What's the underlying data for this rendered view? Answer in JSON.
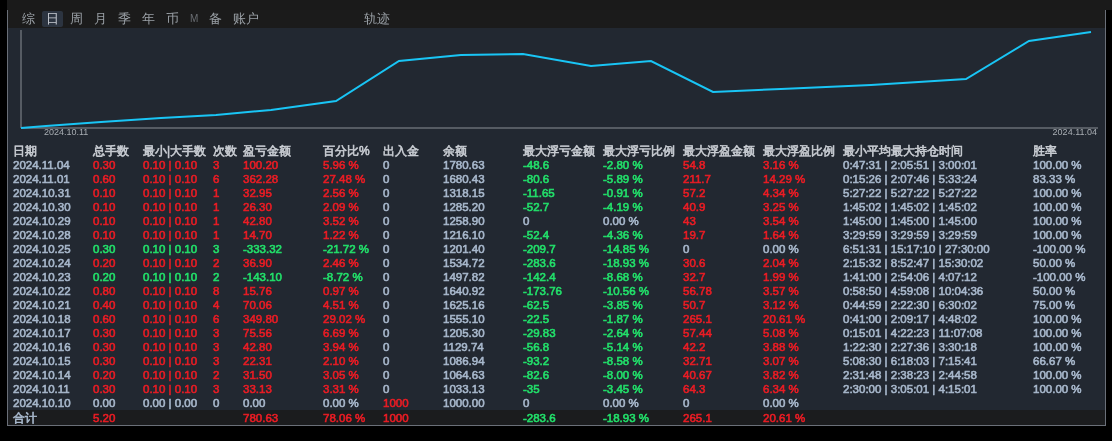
{
  "tabs": [
    {
      "label": "综",
      "selected": false,
      "dim": false
    },
    {
      "label": "日",
      "selected": true,
      "dim": false
    },
    {
      "label": "周",
      "selected": false,
      "dim": false
    },
    {
      "label": "月",
      "selected": false,
      "dim": false
    },
    {
      "label": "季",
      "selected": false,
      "dim": false
    },
    {
      "label": "年",
      "selected": false,
      "dim": false
    },
    {
      "label": "币",
      "selected": false,
      "dim": false
    },
    {
      "label": "M",
      "selected": false,
      "dim": true
    },
    {
      "label": "备",
      "selected": false,
      "dim": false
    },
    {
      "label": "账户",
      "selected": false,
      "dim": false
    },
    {
      "label": "轨迹",
      "selected": false,
      "dim": false,
      "kind": "far"
    }
  ],
  "chart": {
    "start_label": "2024.10.11",
    "end_label": "2024.11.04"
  },
  "table": {
    "columns": [
      "日期",
      "总手数",
      "最小|大手数",
      "次数",
      "盈亏金额",
      "百分比%",
      "出入金",
      "余额",
      "最大浮亏金额",
      "最大浮亏比例",
      "最大浮盈金额",
      "最大浮盈比例",
      "最小平均最大持仓时间",
      "胜率"
    ],
    "rows": [
      {
        "cells": [
          {
            "text": "2024.11.04",
            "color": "#a8b8cc"
          },
          {
            "text": "0.30",
            "color": "#ec1c24"
          },
          {
            "text": "0.10 | 0.10",
            "color": "#ec1c24"
          },
          {
            "text": "3",
            "color": "#ec1c24"
          },
          {
            "text": "100.20",
            "color": "#ec1c24"
          },
          {
            "text": "5.96 %",
            "color": "#ec1c24"
          },
          {
            "text": "0",
            "color": "#a8b8cc"
          },
          {
            "text": "1780.63",
            "color": "#a8b8cc"
          },
          {
            "text": "-48.6",
            "color": "#22e06a"
          },
          {
            "text": "-2.80 %",
            "color": "#22e06a"
          },
          {
            "text": "54.8",
            "color": "#ec1c24"
          },
          {
            "text": "3.16 %",
            "color": "#ec1c24"
          },
          {
            "text": "0:47:31 | 2:05:51 | 3:00:01",
            "color": "#a8b8cc"
          },
          {
            "text": "100.00 %",
            "color": "#a8b8cc"
          }
        ]
      },
      {
        "cells": [
          {
            "text": "2024.11.01",
            "color": "#a8b8cc"
          },
          {
            "text": "0.60",
            "color": "#ec1c24"
          },
          {
            "text": "0.10 | 0.10",
            "color": "#ec1c24"
          },
          {
            "text": "6",
            "color": "#ec1c24"
          },
          {
            "text": "362.28",
            "color": "#ec1c24"
          },
          {
            "text": "27.48 %",
            "color": "#ec1c24"
          },
          {
            "text": "0",
            "color": "#a8b8cc"
          },
          {
            "text": "1680.43",
            "color": "#a8b8cc"
          },
          {
            "text": "-80.6",
            "color": "#22e06a"
          },
          {
            "text": "-5.89 %",
            "color": "#22e06a"
          },
          {
            "text": "211.7",
            "color": "#ec1c24"
          },
          {
            "text": "14.29 %",
            "color": "#ec1c24"
          },
          {
            "text": "0:15:26 | 2:07:46 | 5:33:24",
            "color": "#a8b8cc"
          },
          {
            "text": "83.33 %",
            "color": "#a8b8cc"
          }
        ]
      },
      {
        "cells": [
          {
            "text": "2024.10.31",
            "color": "#a8b8cc"
          },
          {
            "text": "0.10",
            "color": "#ec1c24"
          },
          {
            "text": "0.10 | 0.10",
            "color": "#ec1c24"
          },
          {
            "text": "1",
            "color": "#ec1c24"
          },
          {
            "text": "32.95",
            "color": "#ec1c24"
          },
          {
            "text": "2.56 %",
            "color": "#ec1c24"
          },
          {
            "text": "0",
            "color": "#a8b8cc"
          },
          {
            "text": "1318.15",
            "color": "#a8b8cc"
          },
          {
            "text": "-11.65",
            "color": "#22e06a"
          },
          {
            "text": "-0.91 %",
            "color": "#22e06a"
          },
          {
            "text": "57.2",
            "color": "#ec1c24"
          },
          {
            "text": "4.34 %",
            "color": "#ec1c24"
          },
          {
            "text": "5:27:22 | 5:27:22 | 5:27:22",
            "color": "#a8b8cc"
          },
          {
            "text": "100.00 %",
            "color": "#a8b8cc"
          }
        ]
      },
      {
        "cells": [
          {
            "text": "2024.10.30",
            "color": "#a8b8cc"
          },
          {
            "text": "0.10",
            "color": "#ec1c24"
          },
          {
            "text": "0.10 | 0.10",
            "color": "#ec1c24"
          },
          {
            "text": "1",
            "color": "#ec1c24"
          },
          {
            "text": "26.30",
            "color": "#ec1c24"
          },
          {
            "text": "2.09 %",
            "color": "#ec1c24"
          },
          {
            "text": "0",
            "color": "#a8b8cc"
          },
          {
            "text": "1285.20",
            "color": "#a8b8cc"
          },
          {
            "text": "-52.7",
            "color": "#22e06a"
          },
          {
            "text": "-4.19 %",
            "color": "#22e06a"
          },
          {
            "text": "40.9",
            "color": "#ec1c24"
          },
          {
            "text": "3.25 %",
            "color": "#ec1c24"
          },
          {
            "text": "1:45:02 | 1:45:02 | 1:45:02",
            "color": "#a8b8cc"
          },
          {
            "text": "100.00 %",
            "color": "#a8b8cc"
          }
        ]
      },
      {
        "cells": [
          {
            "text": "2024.10.29",
            "color": "#a8b8cc"
          },
          {
            "text": "0.10",
            "color": "#ec1c24"
          },
          {
            "text": "0.10 | 0.10",
            "color": "#ec1c24"
          },
          {
            "text": "1",
            "color": "#ec1c24"
          },
          {
            "text": "42.80",
            "color": "#ec1c24"
          },
          {
            "text": "3.52 %",
            "color": "#ec1c24"
          },
          {
            "text": "0",
            "color": "#a8b8cc"
          },
          {
            "text": "1258.90",
            "color": "#a8b8cc"
          },
          {
            "text": "0",
            "color": "#a8b8cc"
          },
          {
            "text": "0.00 %",
            "color": "#a8b8cc"
          },
          {
            "text": "43",
            "color": "#ec1c24"
          },
          {
            "text": "3.54 %",
            "color": "#ec1c24"
          },
          {
            "text": "1:45:00 | 1:45:00 | 1:45:00",
            "color": "#a8b8cc"
          },
          {
            "text": "100.00 %",
            "color": "#a8b8cc"
          }
        ]
      },
      {
        "cells": [
          {
            "text": "2024.10.28",
            "color": "#a8b8cc"
          },
          {
            "text": "0.10",
            "color": "#ec1c24"
          },
          {
            "text": "0.10 | 0.10",
            "color": "#ec1c24"
          },
          {
            "text": "1",
            "color": "#ec1c24"
          },
          {
            "text": "14.70",
            "color": "#ec1c24"
          },
          {
            "text": "1.22 %",
            "color": "#ec1c24"
          },
          {
            "text": "0",
            "color": "#a8b8cc"
          },
          {
            "text": "1216.10",
            "color": "#a8b8cc"
          },
          {
            "text": "-52.4",
            "color": "#22e06a"
          },
          {
            "text": "-4.36 %",
            "color": "#22e06a"
          },
          {
            "text": "19.7",
            "color": "#ec1c24"
          },
          {
            "text": "1.64 %",
            "color": "#ec1c24"
          },
          {
            "text": "3:29:59 | 3:29:59 | 3:29:59",
            "color": "#a8b8cc"
          },
          {
            "text": "100.00 %",
            "color": "#a8b8cc"
          }
        ]
      },
      {
        "cells": [
          {
            "text": "2024.10.25",
            "color": "#a8b8cc"
          },
          {
            "text": "0.30",
            "color": "#22e06a"
          },
          {
            "text": "0.10 | 0.10",
            "color": "#22e06a"
          },
          {
            "text": "3",
            "color": "#22e06a"
          },
          {
            "text": "-333.32",
            "color": "#22e06a"
          },
          {
            "text": "-21.72 %",
            "color": "#22e06a"
          },
          {
            "text": "0",
            "color": "#a8b8cc"
          },
          {
            "text": "1201.40",
            "color": "#a8b8cc"
          },
          {
            "text": "-209.7",
            "color": "#22e06a"
          },
          {
            "text": "-14.85 %",
            "color": "#22e06a"
          },
          {
            "text": "0",
            "color": "#a8b8cc"
          },
          {
            "text": "0.00 %",
            "color": "#a8b8cc"
          },
          {
            "text": "6:51:31 | 15:17:10 | 27:30:00",
            "color": "#a8b8cc"
          },
          {
            "text": "-100.00 %",
            "color": "#a8b8cc"
          }
        ]
      },
      {
        "cells": [
          {
            "text": "2024.10.24",
            "color": "#a8b8cc"
          },
          {
            "text": "0.20",
            "color": "#ec1c24"
          },
          {
            "text": "0.10 | 0.10",
            "color": "#ec1c24"
          },
          {
            "text": "2",
            "color": "#ec1c24"
          },
          {
            "text": "36.90",
            "color": "#ec1c24"
          },
          {
            "text": "2.46 %",
            "color": "#ec1c24"
          },
          {
            "text": "0",
            "color": "#a8b8cc"
          },
          {
            "text": "1534.72",
            "color": "#a8b8cc"
          },
          {
            "text": "-283.6",
            "color": "#22e06a"
          },
          {
            "text": "-18.93 %",
            "color": "#22e06a"
          },
          {
            "text": "30.6",
            "color": "#ec1c24"
          },
          {
            "text": "2.04 %",
            "color": "#ec1c24"
          },
          {
            "text": "2:15:32 | 8:52:47 | 15:30:02",
            "color": "#a8b8cc"
          },
          {
            "text": "50.00 %",
            "color": "#a8b8cc"
          }
        ]
      },
      {
        "cells": [
          {
            "text": "2024.10.23",
            "color": "#a8b8cc"
          },
          {
            "text": "0.20",
            "color": "#22e06a"
          },
          {
            "text": "0.10 | 0.10",
            "color": "#22e06a"
          },
          {
            "text": "2",
            "color": "#22e06a"
          },
          {
            "text": "-143.10",
            "color": "#22e06a"
          },
          {
            "text": "-8.72 %",
            "color": "#22e06a"
          },
          {
            "text": "0",
            "color": "#a8b8cc"
          },
          {
            "text": "1497.82",
            "color": "#a8b8cc"
          },
          {
            "text": "-142.4",
            "color": "#22e06a"
          },
          {
            "text": "-8.68 %",
            "color": "#22e06a"
          },
          {
            "text": "32.7",
            "color": "#ec1c24"
          },
          {
            "text": "1.99 %",
            "color": "#ec1c24"
          },
          {
            "text": "1:41:00 | 2:54:06 | 4:07:12",
            "color": "#a8b8cc"
          },
          {
            "text": "-100.00 %",
            "color": "#a8b8cc"
          }
        ]
      },
      {
        "cells": [
          {
            "text": "2024.10.22",
            "color": "#a8b8cc"
          },
          {
            "text": "0.80",
            "color": "#ec1c24"
          },
          {
            "text": "0.10 | 0.10",
            "color": "#ec1c24"
          },
          {
            "text": "8",
            "color": "#ec1c24"
          },
          {
            "text": "15.76",
            "color": "#ec1c24"
          },
          {
            "text": "0.97 %",
            "color": "#ec1c24"
          },
          {
            "text": "0",
            "color": "#a8b8cc"
          },
          {
            "text": "1640.92",
            "color": "#a8b8cc"
          },
          {
            "text": "-173.76",
            "color": "#22e06a"
          },
          {
            "text": "-10.56 %",
            "color": "#22e06a"
          },
          {
            "text": "56.78",
            "color": "#ec1c24"
          },
          {
            "text": "3.57 %",
            "color": "#ec1c24"
          },
          {
            "text": "0:58:50 | 4:59:08 | 10:04:36",
            "color": "#a8b8cc"
          },
          {
            "text": "50.00 %",
            "color": "#a8b8cc"
          }
        ]
      },
      {
        "cells": [
          {
            "text": "2024.10.21",
            "color": "#a8b8cc"
          },
          {
            "text": "0.40",
            "color": "#ec1c24"
          },
          {
            "text": "0.10 | 0.10",
            "color": "#ec1c24"
          },
          {
            "text": "4",
            "color": "#ec1c24"
          },
          {
            "text": "70.06",
            "color": "#ec1c24"
          },
          {
            "text": "4.51 %",
            "color": "#ec1c24"
          },
          {
            "text": "0",
            "color": "#a8b8cc"
          },
          {
            "text": "1625.16",
            "color": "#a8b8cc"
          },
          {
            "text": "-62.5",
            "color": "#22e06a"
          },
          {
            "text": "-3.85 %",
            "color": "#22e06a"
          },
          {
            "text": "50.7",
            "color": "#ec1c24"
          },
          {
            "text": "3.12 %",
            "color": "#ec1c24"
          },
          {
            "text": "0:44:59 | 2:22:30 | 6:30:02",
            "color": "#a8b8cc"
          },
          {
            "text": "75.00 %",
            "color": "#a8b8cc"
          }
        ]
      },
      {
        "cells": [
          {
            "text": "2024.10.18",
            "color": "#a8b8cc"
          },
          {
            "text": "0.60",
            "color": "#ec1c24"
          },
          {
            "text": "0.10 | 0.10",
            "color": "#ec1c24"
          },
          {
            "text": "6",
            "color": "#ec1c24"
          },
          {
            "text": "349.80",
            "color": "#ec1c24"
          },
          {
            "text": "29.02 %",
            "color": "#ec1c24"
          },
          {
            "text": "0",
            "color": "#a8b8cc"
          },
          {
            "text": "1555.10",
            "color": "#a8b8cc"
          },
          {
            "text": "-22.5",
            "color": "#22e06a"
          },
          {
            "text": "-1.87 %",
            "color": "#22e06a"
          },
          {
            "text": "265.1",
            "color": "#ec1c24"
          },
          {
            "text": "20.61 %",
            "color": "#ec1c24"
          },
          {
            "text": "0:41:00 | 2:09:17 | 4:48:02",
            "color": "#a8b8cc"
          },
          {
            "text": "100.00 %",
            "color": "#a8b8cc"
          }
        ]
      },
      {
        "cells": [
          {
            "text": "2024.10.17",
            "color": "#a8b8cc"
          },
          {
            "text": "0.30",
            "color": "#ec1c24"
          },
          {
            "text": "0.10 | 0.10",
            "color": "#ec1c24"
          },
          {
            "text": "3",
            "color": "#ec1c24"
          },
          {
            "text": "75.56",
            "color": "#ec1c24"
          },
          {
            "text": "6.69 %",
            "color": "#ec1c24"
          },
          {
            "text": "0",
            "color": "#a8b8cc"
          },
          {
            "text": "1205.30",
            "color": "#a8b8cc"
          },
          {
            "text": "-29.83",
            "color": "#22e06a"
          },
          {
            "text": "-2.64 %",
            "color": "#22e06a"
          },
          {
            "text": "57.44",
            "color": "#ec1c24"
          },
          {
            "text": "5.08 %",
            "color": "#ec1c24"
          },
          {
            "text": "0:15:01 | 4:22:23 | 11:07:08",
            "color": "#a8b8cc"
          },
          {
            "text": "100.00 %",
            "color": "#a8b8cc"
          }
        ]
      },
      {
        "cells": [
          {
            "text": "2024.10.16",
            "color": "#a8b8cc"
          },
          {
            "text": "0.30",
            "color": "#ec1c24"
          },
          {
            "text": "0.10 | 0.10",
            "color": "#ec1c24"
          },
          {
            "text": "3",
            "color": "#ec1c24"
          },
          {
            "text": "42.80",
            "color": "#ec1c24"
          },
          {
            "text": "3.94 %",
            "color": "#ec1c24"
          },
          {
            "text": "0",
            "color": "#a8b8cc"
          },
          {
            "text": "1129.74",
            "color": "#a8b8cc"
          },
          {
            "text": "-56.8",
            "color": "#22e06a"
          },
          {
            "text": "-5.14 %",
            "color": "#22e06a"
          },
          {
            "text": "42.2",
            "color": "#ec1c24"
          },
          {
            "text": "3.88 %",
            "color": "#ec1c24"
          },
          {
            "text": "1:22:30 | 2:27:36 | 3:30:18",
            "color": "#a8b8cc"
          },
          {
            "text": "100.00 %",
            "color": "#a8b8cc"
          }
        ]
      },
      {
        "cells": [
          {
            "text": "2024.10.15",
            "color": "#a8b8cc"
          },
          {
            "text": "0.30",
            "color": "#ec1c24"
          },
          {
            "text": "0.10 | 0.10",
            "color": "#ec1c24"
          },
          {
            "text": "3",
            "color": "#ec1c24"
          },
          {
            "text": "22.31",
            "color": "#ec1c24"
          },
          {
            "text": "2.10 %",
            "color": "#ec1c24"
          },
          {
            "text": "0",
            "color": "#a8b8cc"
          },
          {
            "text": "1086.94",
            "color": "#a8b8cc"
          },
          {
            "text": "-93.2",
            "color": "#22e06a"
          },
          {
            "text": "-8.58 %",
            "color": "#22e06a"
          },
          {
            "text": "32.71",
            "color": "#ec1c24"
          },
          {
            "text": "3.07 %",
            "color": "#ec1c24"
          },
          {
            "text": "5:08:30 | 6:18:03 | 7:15:41",
            "color": "#a8b8cc"
          },
          {
            "text": "66.67 %",
            "color": "#a8b8cc"
          }
        ]
      },
      {
        "cells": [
          {
            "text": "2024.10.14",
            "color": "#a8b8cc"
          },
          {
            "text": "0.20",
            "color": "#ec1c24"
          },
          {
            "text": "0.10 | 0.10",
            "color": "#ec1c24"
          },
          {
            "text": "2",
            "color": "#ec1c24"
          },
          {
            "text": "31.50",
            "color": "#ec1c24"
          },
          {
            "text": "3.05 %",
            "color": "#ec1c24"
          },
          {
            "text": "0",
            "color": "#a8b8cc"
          },
          {
            "text": "1064.63",
            "color": "#a8b8cc"
          },
          {
            "text": "-82.6",
            "color": "#22e06a"
          },
          {
            "text": "-8.00 %",
            "color": "#22e06a"
          },
          {
            "text": "40.67",
            "color": "#ec1c24"
          },
          {
            "text": "3.82 %",
            "color": "#ec1c24"
          },
          {
            "text": "2:31:48 | 2:38:23 | 2:44:58",
            "color": "#a8b8cc"
          },
          {
            "text": "100.00 %",
            "color": "#a8b8cc"
          }
        ]
      },
      {
        "cells": [
          {
            "text": "2024.10.11",
            "color": "#a8b8cc"
          },
          {
            "text": "0.30",
            "color": "#ec1c24"
          },
          {
            "text": "0.10 | 0.10",
            "color": "#ec1c24"
          },
          {
            "text": "3",
            "color": "#ec1c24"
          },
          {
            "text": "33.13",
            "color": "#ec1c24"
          },
          {
            "text": "3.31 %",
            "color": "#ec1c24"
          },
          {
            "text": "0",
            "color": "#a8b8cc"
          },
          {
            "text": "1033.13",
            "color": "#a8b8cc"
          },
          {
            "text": "-35",
            "color": "#22e06a"
          },
          {
            "text": "-3.45 %",
            "color": "#22e06a"
          },
          {
            "text": "64.3",
            "color": "#ec1c24"
          },
          {
            "text": "6.34 %",
            "color": "#ec1c24"
          },
          {
            "text": "2:30:00 | 3:05:01 | 4:15:01",
            "color": "#a8b8cc"
          },
          {
            "text": "100.00 %",
            "color": "#a8b8cc"
          }
        ]
      },
      {
        "cells": [
          {
            "text": "2024.10.10",
            "color": "#a8b8cc"
          },
          {
            "text": "0.00",
            "color": "#a8b8cc"
          },
          {
            "text": "0.00 | 0.00",
            "color": "#a8b8cc"
          },
          {
            "text": "0",
            "color": "#a8b8cc"
          },
          {
            "text": "0.00",
            "color": "#a8b8cc"
          },
          {
            "text": "0.00 %",
            "color": "#a8b8cc"
          },
          {
            "text": "1000",
            "color": "#ec1c24"
          },
          {
            "text": "1000.00",
            "color": "#a8b8cc"
          },
          {
            "text": "0",
            "color": "#a8b8cc"
          },
          {
            "text": "0.00 %",
            "color": "#a8b8cc"
          },
          {
            "text": "0",
            "color": "#a8b8cc"
          },
          {
            "text": "0.00 %",
            "color": "#a8b8cc"
          },
          null,
          null
        ]
      }
    ],
    "total": {
      "cells": [
        {
          "text": "合计",
          "color": "#a8b8cc"
        },
        {
          "text": "5.20",
          "color": "#ec1c24"
        },
        null,
        null,
        {
          "text": "780.63",
          "color": "#ec1c24"
        },
        {
          "text": "78.06 %",
          "color": "#ec1c24"
        },
        {
          "text": "1000",
          "color": "#ec1c24"
        },
        null,
        {
          "text": "-283.6",
          "color": "#22e06a"
        },
        {
          "text": "-18.93 %",
          "color": "#22e06a"
        },
        {
          "text": "265.1",
          "color": "#ec1c24"
        },
        {
          "text": "20.61 %",
          "color": "#ec1c24"
        },
        null,
        null
      ]
    }
  }
}
